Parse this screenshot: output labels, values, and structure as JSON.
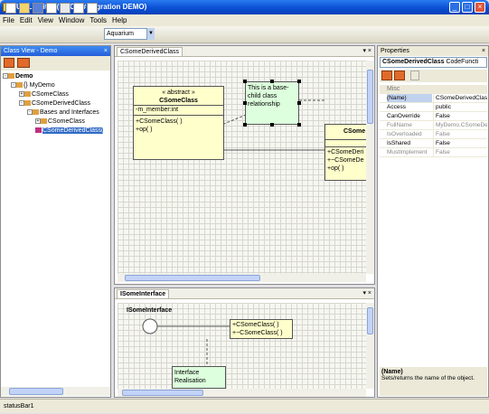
{
  "window": {
    "title": "UML Editor (MFC C# Migration DEMO)"
  },
  "menu": [
    "File",
    "Edit",
    "View",
    "Window",
    "Tools",
    "Help"
  ],
  "toolbar": {
    "combo_value": "Aquarium"
  },
  "class_view": {
    "title": "Class View - Demo",
    "tree": [
      {
        "label": "Demo",
        "level": 0,
        "expander": "-",
        "bold": true
      },
      {
        "label": "{} MyDemo",
        "level": 1,
        "expander": "-"
      },
      {
        "label": "CSomeClass",
        "level": 2,
        "expander": "+"
      },
      {
        "label": "CSomeDerivedClass",
        "level": 2,
        "expander": "-"
      },
      {
        "label": "Bases and Interfaces",
        "level": 3,
        "expander": "-"
      },
      {
        "label": "CSomeClass",
        "level": 4,
        "expander": "+"
      },
      {
        "label": "CSomeDerivedClass(",
        "level": 4,
        "expander": "",
        "selected": true
      }
    ]
  },
  "doc1": {
    "tab": "CSomeDerivedClass",
    "abstract_class": {
      "stereotype": "« abstract »",
      "name": "CSomeClass",
      "attribute": "-m_member:int",
      "methods": [
        "+CSomeClass( )",
        "+op( )"
      ]
    },
    "note": "This is a base-child class relationship",
    "derived": {
      "name": "CSome",
      "methods": [
        "+CSomeDeri",
        "+~CSomeDe",
        "+op( )"
      ]
    }
  },
  "doc2": {
    "tab": "ISomeInterface",
    "interface_name": "ISomeInterface",
    "class_methods": [
      "+CSomeClass( )",
      "+~CSomeClass( )"
    ],
    "note": "Interface Realisation"
  },
  "properties": {
    "title": "Properties",
    "object": "CSomeDerivedClass",
    "object_type": "CodeFuncti",
    "category": "Misc",
    "rows": [
      {
        "name": "(Name)",
        "value": "CSomeDerivedClass",
        "selected": true
      },
      {
        "name": "Access",
        "value": "public"
      },
      {
        "name": "CanOverride",
        "value": "False"
      },
      {
        "name": "FullName",
        "value": "MyDemo.CSomeDeri",
        "grey": true
      },
      {
        "name": "IsOverloaded",
        "value": "False",
        "grey": true
      },
      {
        "name": "IsShared",
        "value": "False"
      },
      {
        "name": "MustImplement",
        "value": "False",
        "grey": true
      }
    ],
    "desc_title": "(Name)",
    "desc_text": "Sets/returns the name of the object."
  },
  "status": {
    "text": "statusBar1"
  },
  "colors": {
    "title": "#0a4fd4",
    "class_fill": "#ffffcc",
    "note_fill": "#ddffdd"
  }
}
